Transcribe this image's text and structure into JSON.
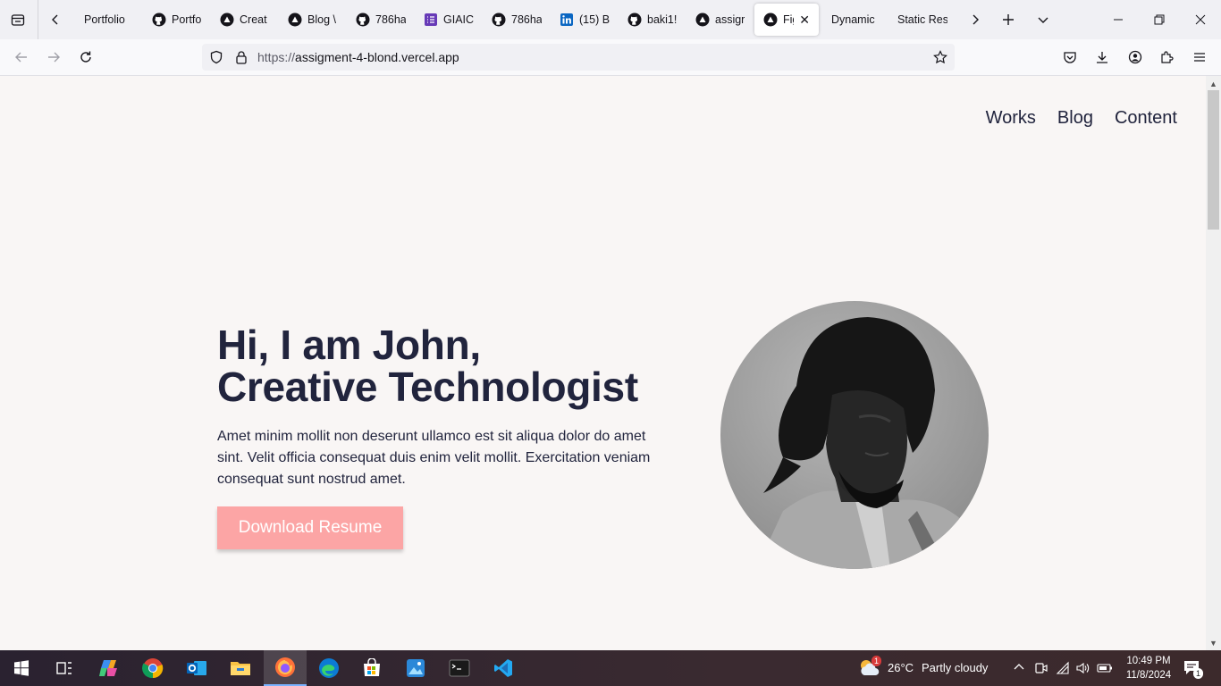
{
  "browser": {
    "tabs": [
      {
        "label": "Portfolio",
        "icon": "none"
      },
      {
        "label": "Portfo",
        "icon": "github-icon"
      },
      {
        "label": "Creat",
        "icon": "vercel-icon"
      },
      {
        "label": "Blog \\",
        "icon": "vercel-icon"
      },
      {
        "label": "786ha",
        "icon": "github-icon"
      },
      {
        "label": "GIAIC",
        "icon": "form-icon"
      },
      {
        "label": "786ha",
        "icon": "github-icon"
      },
      {
        "label": "(15) B",
        "icon": "linkedin-icon"
      },
      {
        "label": "baki1!",
        "icon": "github-icon"
      },
      {
        "label": "assigr",
        "icon": "vercel-icon"
      },
      {
        "label": "Fig",
        "icon": "vercel-icon",
        "active": true
      },
      {
        "label": "Dynamic",
        "icon": "none"
      },
      {
        "label": "Static Res",
        "icon": "none"
      }
    ],
    "url_scheme": "https://",
    "url_host": "assigment-4-blond.vercel.app"
  },
  "site": {
    "nav": [
      "Works",
      "Blog",
      "Content"
    ],
    "hero_line1": "Hi, I am John,",
    "hero_line2": "Creative Technologist",
    "hero_text": "Amet minim mollit non deserunt ullamco est sit aliqua dolor do amet sint. Velit officia consequat duis enim velit mollit. Exercitation veniam consequat sunt nostrud amet.",
    "cta_label": "Download Resume",
    "cta_color": "#ff6464"
  },
  "taskbar": {
    "weather_temp": "26°C",
    "weather_desc": "Partly cloudy",
    "weather_badge": "1",
    "time": "10:49 PM",
    "date": "11/8/2024",
    "notification_count": "1"
  }
}
